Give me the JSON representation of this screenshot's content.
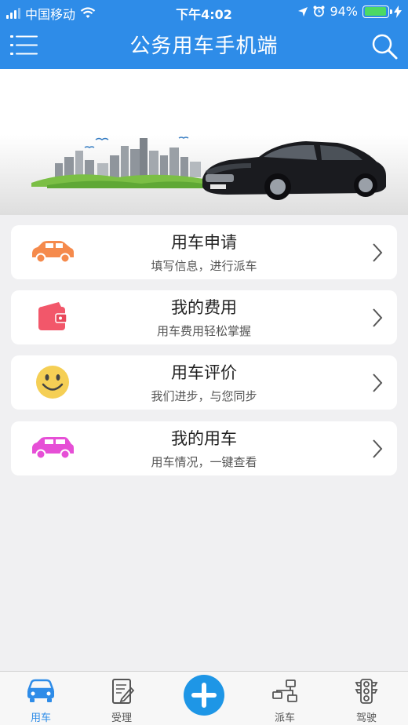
{
  "status_bar": {
    "carrier": "中国移动",
    "time": "下午4:02",
    "battery": "94%",
    "battery_level": 0.94
  },
  "header": {
    "title": "公务用车手机端",
    "menu_icon": "menu-icon",
    "search_icon": "search-icon"
  },
  "cards": [
    {
      "title": "用车申请",
      "subtitle": "填写信息，进行派车",
      "icon": "car-icon",
      "icon_color": "#f58a4c"
    },
    {
      "title": "我的费用",
      "subtitle": "用车费用轻松掌握",
      "icon": "wallet-icon",
      "icon_color": "#f2576a"
    },
    {
      "title": "用车评价",
      "subtitle": "我们进步，与您同步",
      "icon": "smiley-icon",
      "icon_color": "#f5cf55"
    },
    {
      "title": "我的用车",
      "subtitle": "用车情况，一键查看",
      "icon": "suv-icon",
      "icon_color": "#e64fd6"
    }
  ],
  "tab_bar": {
    "tabs": [
      {
        "label": "用车",
        "icon": "car-front-icon",
        "active": true
      },
      {
        "label": "受理",
        "icon": "document-edit-icon",
        "active": false
      },
      {
        "label": "",
        "icon": "plus-icon",
        "active": false
      },
      {
        "label": "派车",
        "icon": "dispatch-network-icon",
        "active": false
      },
      {
        "label": "驾驶",
        "icon": "traffic-light-icon",
        "active": false
      }
    ]
  },
  "colors": {
    "primary": "#2e8ce8",
    "background": "#f0f0f2",
    "active_tab": "#2e8ce8"
  }
}
